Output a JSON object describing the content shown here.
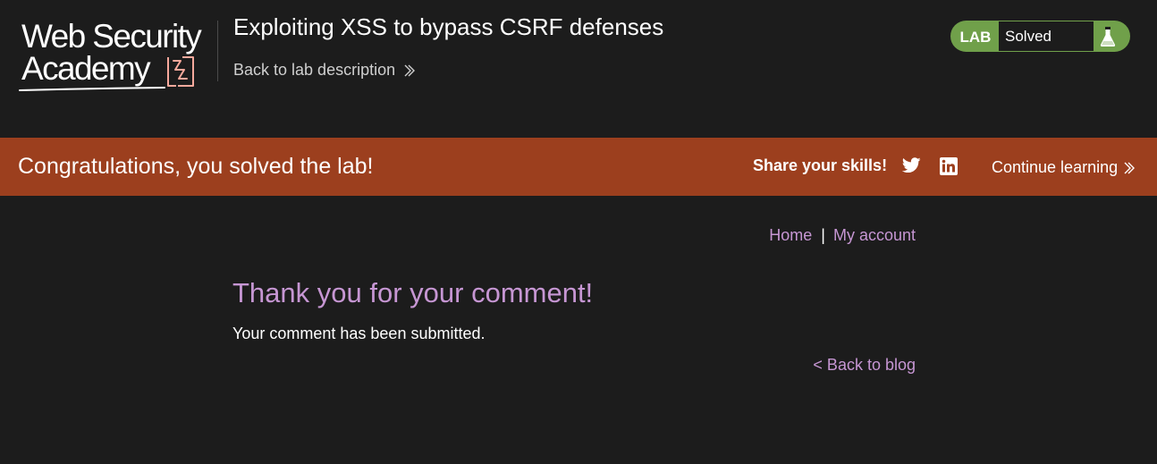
{
  "header": {
    "logo": {
      "line1": "Web Security",
      "line2": "Academy"
    },
    "lab_title": "Exploiting XSS to bypass CSRF defenses",
    "back_to_description": "Back to lab description",
    "status": {
      "label": "LAB",
      "value": "Solved",
      "icon": "flask-icon"
    }
  },
  "banner": {
    "message": "Congratulations, you solved the lab!",
    "share_label": "Share your skills!",
    "share_icons": [
      "twitter-icon",
      "linkedin-icon"
    ],
    "continue_label": "Continue learning"
  },
  "nav": {
    "home": "Home",
    "separator": "|",
    "my_account": "My account"
  },
  "main": {
    "heading": "Thank you for your comment!",
    "message": "Your comment has been submitted.",
    "back_link": "< Back to blog"
  },
  "colors": {
    "background": "#1c1c1c",
    "banner": "#9c3f1e",
    "status_green": "#70a04a",
    "link_purple": "#c696d3",
    "logo_accent": "#f8a99c"
  }
}
